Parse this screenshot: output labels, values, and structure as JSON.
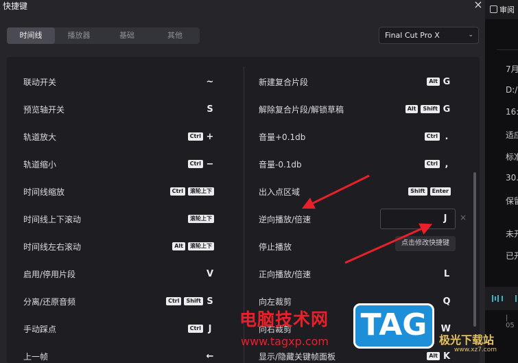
{
  "dialog": {
    "title": "快捷键",
    "close_glyph": "×"
  },
  "tabs": [
    {
      "label": "时间线",
      "active": true
    },
    {
      "label": "播放器",
      "active": false
    },
    {
      "label": "基础",
      "active": false
    },
    {
      "label": "其他",
      "active": false
    }
  ],
  "preset": {
    "value": "Final Cut Pro X",
    "chevron": "⌄"
  },
  "left_shortcuts": [
    {
      "label": "联动开关",
      "keys": [],
      "key": "~"
    },
    {
      "label": "预览轴开关",
      "keys": [],
      "key": "S"
    },
    {
      "label": "轨道放大",
      "keys": [
        "Ctrl"
      ],
      "key": "+"
    },
    {
      "label": "轨道缩小",
      "keys": [
        "Ctrl"
      ],
      "key": "−"
    },
    {
      "label": "时间线缩放",
      "keys": [
        "Ctrl",
        "滚轮上下"
      ],
      "key": ""
    },
    {
      "label": "时间线上下滚动",
      "keys": [
        "滚轮上下"
      ],
      "key": ""
    },
    {
      "label": "时间线左右滚动",
      "keys": [
        "Alt",
        "滚轮上下"
      ],
      "key": ""
    },
    {
      "label": "启用/停用片段",
      "keys": [],
      "key": "V"
    },
    {
      "label": "分离/还原音频",
      "keys": [
        "Ctrl",
        "Shift"
      ],
      "key": "S"
    },
    {
      "label": "手动踩点",
      "keys": [
        "Ctrl"
      ],
      "key": "J"
    },
    {
      "label": "上一帧",
      "keys": [],
      "key": "←"
    }
  ],
  "right_shortcuts": [
    {
      "label": "新建复合片段",
      "keys": [
        "Alt"
      ],
      "key": "G"
    },
    {
      "label": "解除复合片段/解锁草稿",
      "keys": [
        "Alt",
        "Shift"
      ],
      "key": "G"
    },
    {
      "label": "音量+0.1db",
      "keys": [
        "Ctrl"
      ],
      "key": "."
    },
    {
      "label": "音量-0.1db",
      "keys": [
        "Ctrl"
      ],
      "key": ","
    },
    {
      "label": "出入点区域",
      "keys": [
        "Shift",
        "Enter"
      ],
      "key": ""
    },
    {
      "label": "逆向播放/倍速",
      "keys": [],
      "key": ""
    },
    {
      "label": "停止播放",
      "keys": [],
      "key": ""
    },
    {
      "label": "正向播放/倍速",
      "keys": [],
      "key": "L"
    },
    {
      "label": "向左裁剪",
      "keys": [],
      "key": "Q"
    },
    {
      "label": "向右裁剪",
      "keys": [],
      "key": "W"
    },
    {
      "label": "显示/隐藏关键帧面板",
      "keys": [
        "Alt"
      ],
      "key": "K"
    }
  ],
  "editing": {
    "key": "J",
    "clear_glyph": "×",
    "tooltip": "点击修改快捷键"
  },
  "background_app": {
    "review_label": "审阅",
    "lines": [
      "7月",
      "D:/",
      "16:",
      "适应",
      "标准",
      "30.",
      "保留",
      "未开",
      "已开"
    ],
    "timecode": "| 05"
  },
  "watermark": {
    "cn_text": "电脑技术网",
    "url": "www.tagxp.com",
    "logo": "TAG",
    "jg_text": "极光下载站",
    "jg_url": "www.xz7.com"
  },
  "colors": {
    "accent_red": "#e8202a",
    "watermark_blue": "#1d8fd8",
    "wave_cyan": "#36b5c9"
  }
}
